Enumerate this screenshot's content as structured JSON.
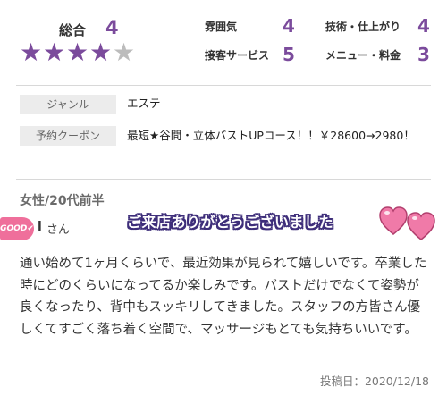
{
  "overall": {
    "label": "総合",
    "score": "4",
    "rating": 4,
    "max": 5
  },
  "ratings": [
    {
      "label": "雰囲気",
      "value": "4"
    },
    {
      "label": "技術・仕上がり",
      "value": "4"
    },
    {
      "label": "接客サービス",
      "value": "5"
    },
    {
      "label": "メニュー・料金",
      "value": "3"
    }
  ],
  "info": {
    "genre": {
      "key": "ジャンル",
      "value": "エステ"
    },
    "coupon": {
      "key": "予約クーポン",
      "value": "最短★谷間・立体バストUPコース！！￥28600→2980！"
    }
  },
  "review": {
    "reviewer_type": "女性/20代前半",
    "badge": "GOOD",
    "name": "i",
    "name_suffix": "さん",
    "thanks_banner": "ご来店ありがとうございました",
    "body": "通い始めて1ヶ月くらいで、最近効果が見られて嬉しいです。卒業した時にどのくらいになってるか楽しみです。バストだけでなくて姿勢が良くなったり、背中もスッキリしてきました。スタッフの方皆さん優しくてすごく落ち着く空間で、マッサージもとても気持ちいいです。",
    "posted_date": "投稿日：2020/12/18"
  },
  "colors": {
    "accent": "#7b4b9c",
    "star_off": "#bcbcbc",
    "badge": "#ef6f9b",
    "heart": "#f07aa8",
    "banner_outline": "#3e2e7a"
  },
  "icons": {
    "star": "star-icon",
    "heart": "heart-icon",
    "thumb": "thumbs-up-icon"
  }
}
